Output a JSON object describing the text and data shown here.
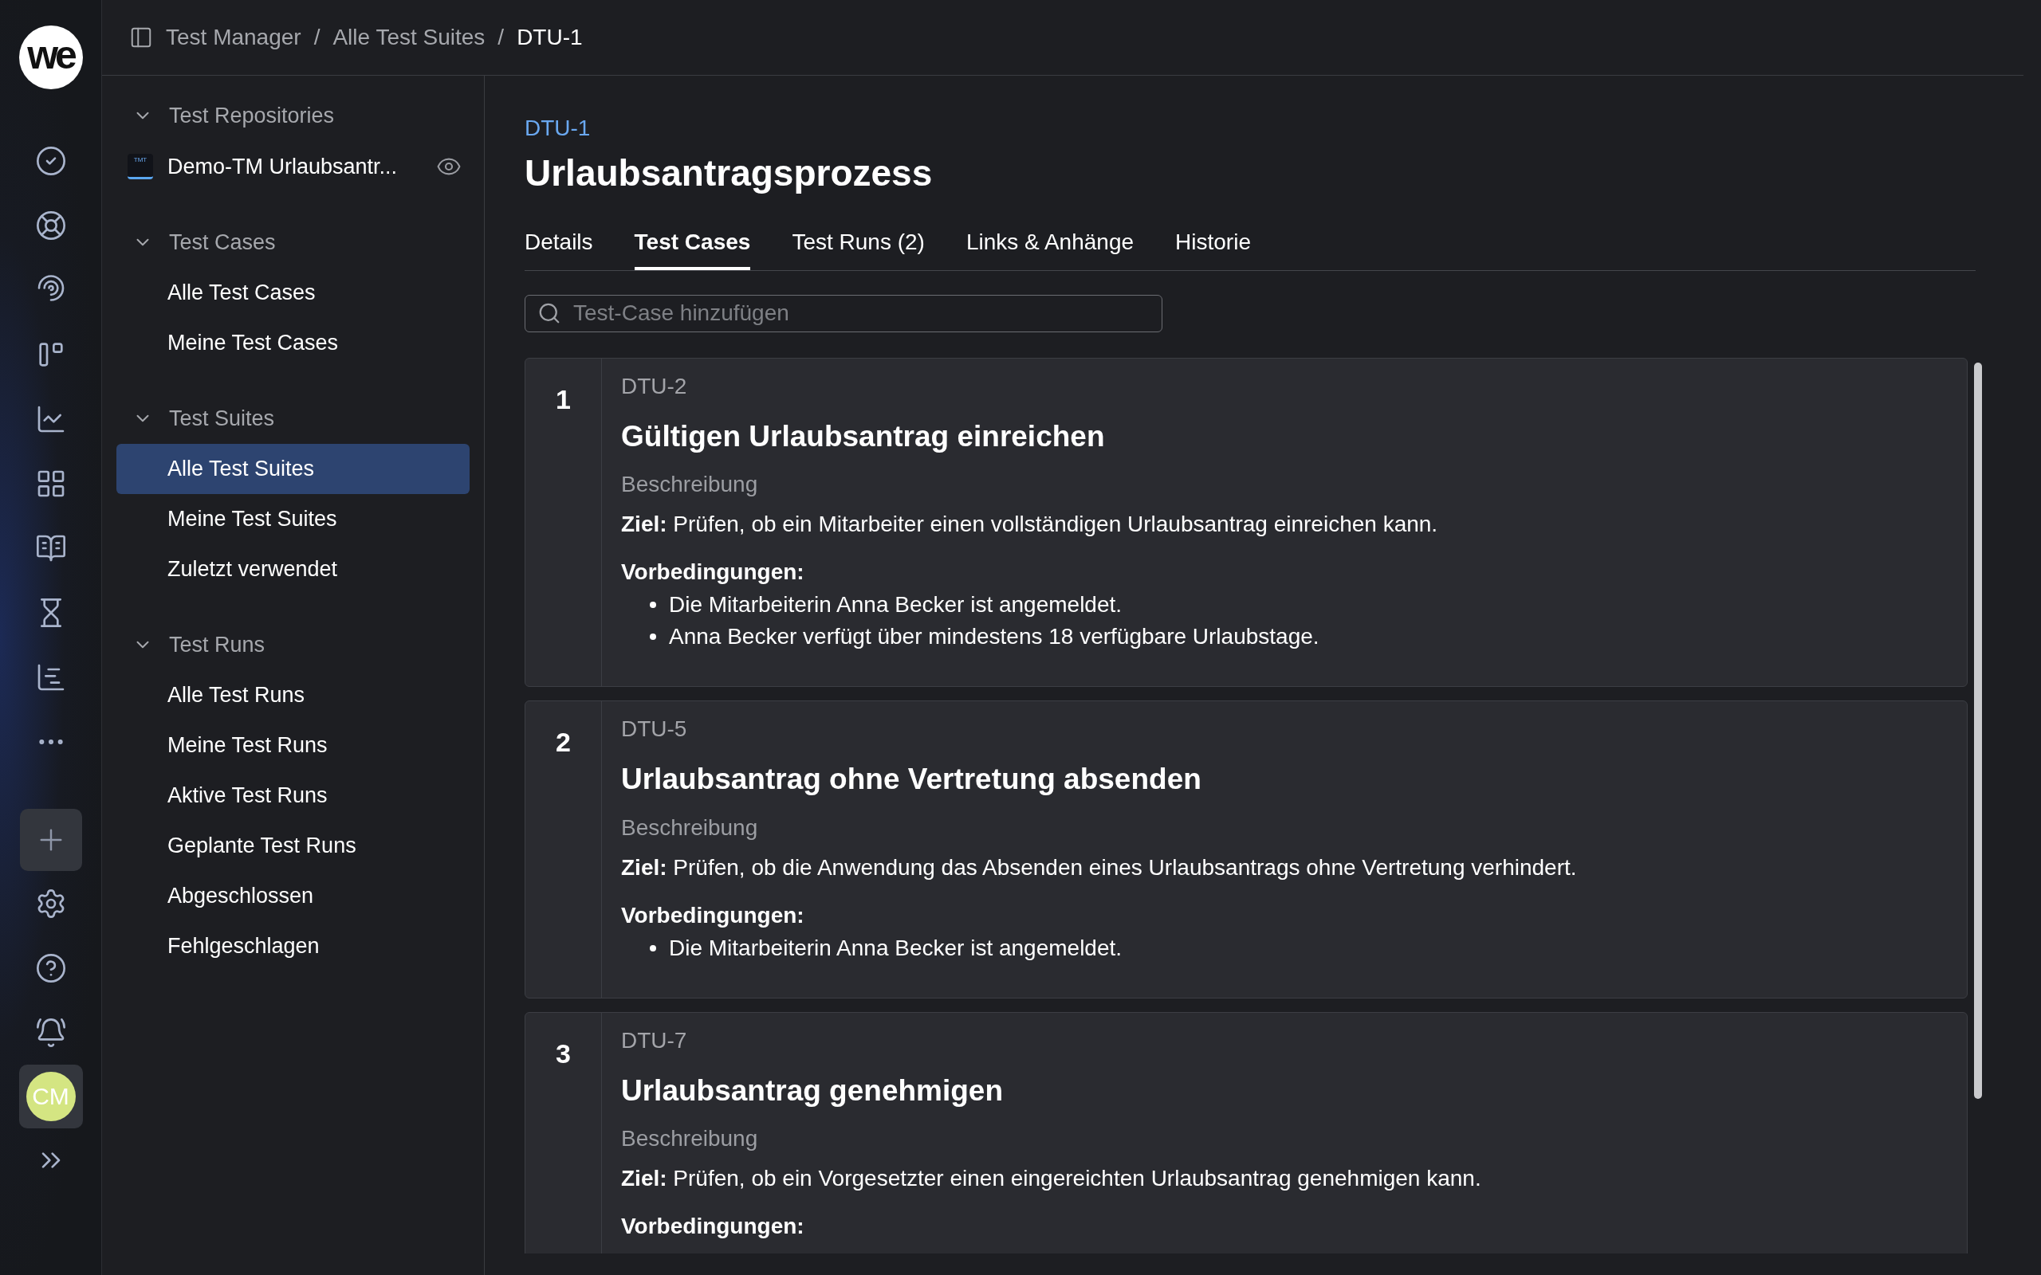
{
  "rail": {
    "logo": "we",
    "avatar": "CM"
  },
  "breadcrumb": {
    "separator": "/",
    "items": [
      "Test Manager",
      "Alle Test Suites",
      "DTU-1"
    ]
  },
  "sidebar": {
    "sections": [
      {
        "title": "Test Repositories",
        "expanded": true,
        "items": [
          {
            "label": "Demo-TM Urlaubsantr...",
            "kind": "repository",
            "badge": "TMT",
            "selected": false
          }
        ]
      },
      {
        "title": "Test Cases",
        "expanded": true,
        "items": [
          {
            "label": "Alle Test Cases",
            "kind": "link",
            "selected": false
          },
          {
            "label": "Meine Test Cases",
            "kind": "link",
            "selected": false
          }
        ]
      },
      {
        "title": "Test Suites",
        "expanded": true,
        "items": [
          {
            "label": "Alle Test Suites",
            "kind": "link",
            "selected": true
          },
          {
            "label": "Meine Test Suites",
            "kind": "link",
            "selected": false
          },
          {
            "label": "Zuletzt verwendet",
            "kind": "link",
            "selected": false
          }
        ]
      },
      {
        "title": "Test Runs",
        "expanded": true,
        "items": [
          {
            "label": "Alle Test Runs",
            "kind": "link",
            "selected": false
          },
          {
            "label": "Meine Test Runs",
            "kind": "link",
            "selected": false
          },
          {
            "label": "Aktive Test Runs",
            "kind": "link",
            "selected": false
          },
          {
            "label": "Geplante Test Runs",
            "kind": "link",
            "selected": false
          },
          {
            "label": "Abgeschlossen",
            "kind": "link",
            "selected": false
          },
          {
            "label": "Fehlgeschlagen",
            "kind": "link",
            "selected": false
          }
        ]
      }
    ]
  },
  "page": {
    "key": "DTU-1",
    "title": "Urlaubsantragsprozess"
  },
  "tabs": [
    {
      "label": "Details",
      "selected": false
    },
    {
      "label": "Test Cases",
      "selected": true
    },
    {
      "label": "Test Runs (2)",
      "selected": false
    },
    {
      "label": "Links & Anhänge",
      "selected": false
    },
    {
      "label": "Historie",
      "selected": false
    }
  ],
  "search": {
    "placeholder": "Test-Case hinzufügen"
  },
  "test_cases": [
    {
      "number": "1",
      "key": "DTU-2",
      "title": "Gültigen Urlaubsantrag einreichen",
      "description_label": "Beschreibung",
      "goal": "**Ziel:** Prüfen, ob ein Mitarbeiter einen vollständigen Urlaubsantrag einreichen kann.",
      "preconditions_label": "Vorbedingungen:",
      "preconditions": [
        "Die Mitarbeiterin Anna Becker ist angemeldet.",
        "Anna Becker verfügt über mindestens 18 verfügbare Urlaubstage."
      ]
    },
    {
      "number": "2",
      "key": "DTU-5",
      "title": "Urlaubsantrag ohne Vertretung absenden",
      "description_label": "Beschreibung",
      "goal": "**Ziel:** Prüfen, ob die Anwendung das Absenden eines Urlaubsantrags ohne Vertretung verhindert.",
      "preconditions_label": "Vorbedingungen:",
      "preconditions": [
        "Die Mitarbeiterin Anna Becker ist angemeldet."
      ]
    },
    {
      "number": "3",
      "key": "DTU-7",
      "title": "Urlaubsantrag genehmigen",
      "description_label": "Beschreibung",
      "goal": "**Ziel:** Prüfen, ob ein Vorgesetzter einen eingereichten Urlaubsantrag genehmigen kann.",
      "preconditions_label": "Vorbedingungen:"
    }
  ]
}
